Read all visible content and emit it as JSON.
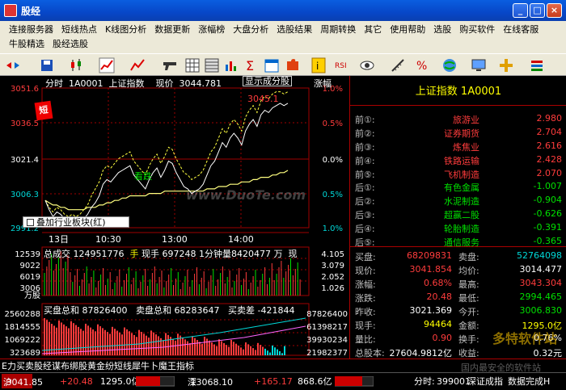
{
  "window": {
    "title": "股经"
  },
  "menu": {
    "row1": [
      "连接服务器",
      "短线热点",
      "K线图分析",
      "数据更新",
      "涨幅榜",
      "大盘分析",
      "选股结果",
      "周期转换",
      "其它",
      "使用帮助",
      "选股",
      "购买软件",
      "在线客服"
    ],
    "row2": [
      "牛股精选",
      "股经选股"
    ]
  },
  "chart": {
    "header": {
      "period": "分时",
      "code": "1A0001",
      "name": "上证指数",
      "price_label": "现价",
      "price": "3044.781",
      "toggle_label": "显示成分股",
      "change_label": "涨幅"
    },
    "y_left": [
      "3051.6",
      "3036.5",
      "3021.4",
      "3006.3",
      "2991.2"
    ],
    "y_right": [
      "1.0%",
      "0.5%",
      "0.0%",
      "0.5%",
      "1.0%"
    ],
    "x_labels": [
      "13日",
      "10:30",
      "13:00",
      "14:00"
    ],
    "peak_label": "3045.1",
    "buy_marker": "短",
    "sell_marker": "看跌",
    "overlay_checkbox": "叠加行业板块(红)",
    "volume_header": {
      "total_label": "总成交",
      "total": "124951776",
      "hand_label": "手",
      "current_label": "现手",
      "current": "697248",
      "sub": "1分钟量",
      "sub_value": "8420477",
      "unit": "万",
      "extra": "现"
    },
    "volume_y_left": [
      "12539",
      "9022",
      "6019",
      "3006",
      "万股"
    ],
    "volume_y_right": [
      "4.105",
      "3.079",
      "2.052",
      "1.026"
    ],
    "bs_header": {
      "buy_label": "买盘总和",
      "buy": "87826400",
      "sell_label": "卖盘总和",
      "sell": "68283647",
      "diff_label": "买卖差",
      "diff": "-421844"
    },
    "bs_y_left": [
      "2560288",
      "1814555",
      "1069222",
      "323689"
    ],
    "bs_y_right": [
      "87826400",
      "61398217",
      "39930234",
      "21982377"
    ],
    "series": {
      "price": [
        3003,
        2999,
        2996,
        2998,
        2997,
        2995,
        2994,
        2995,
        2993,
        2994,
        2995,
        2997,
        3000,
        3002,
        3005,
        3010,
        3012,
        3011,
        3013,
        3015,
        3016,
        3017,
        3018,
        3014,
        3012,
        3010,
        3008,
        3012,
        3015,
        3017,
        3013,
        3016,
        3020,
        3019,
        3015,
        3012,
        3009,
        3008,
        3006,
        3007,
        3008,
        3010,
        3014,
        3018,
        3020,
        3024,
        3028,
        3026,
        3030,
        3032,
        3030,
        3027,
        3033,
        3036,
        3038,
        3035,
        3040,
        3042,
        3041,
        3043,
        3044,
        3045,
        3044,
        3045
      ],
      "price_lead": [
        3003,
        3000,
        2998,
        3000,
        2999,
        2997,
        2996,
        2997,
        2996,
        2997,
        2999,
        3001,
        3005,
        3008,
        3011,
        3016,
        3018,
        3017,
        3019,
        3021,
        3022,
        3023,
        3024,
        3020,
        3018,
        3016,
        3014,
        3018,
        3021,
        3023,
        3019,
        3022,
        3026,
        3025,
        3021,
        3018,
        3015,
        3014,
        3012,
        3013,
        3014,
        3016,
        3020,
        3024,
        3026,
        3030,
        3034,
        3032,
        3036,
        3038,
        3036,
        3033,
        3039,
        3042,
        3044,
        3041,
        3046,
        3048,
        3047,
        3049,
        3050,
        3050,
        3049,
        3050
      ],
      "avg": [
        3003,
        3002,
        3001,
        3001,
        3000,
        3000,
        2999,
        2999,
        2999,
        2999,
        2999,
        3000,
        3000,
        3000,
        3001,
        3001,
        3002,
        3002,
        3003,
        3003,
        3004,
        3004,
        3005,
        3005,
        3005,
        3005,
        3005,
        3006,
        3006,
        3006,
        3006,
        3007,
        3007,
        3007,
        3007,
        3007,
        3007,
        3007,
        3007,
        3007,
        3007,
        3007,
        3008,
        3008,
        3008,
        3009,
        3009,
        3009,
        3010,
        3010,
        3010,
        3011,
        3011,
        3011,
        3012,
        3012,
        3013,
        3013,
        3013,
        3014,
        3014,
        3015,
        3015,
        3016
      ],
      "ref": 3021.369
    },
    "colors": {
      "up": "#ff3c3c",
      "down": "#00e000",
      "grid": "#a00000",
      "price": "#ffffff",
      "avg": "#ffff80",
      "lead": "#ffff40"
    }
  },
  "info": {
    "title": "上证指数  1A0001",
    "top5": [
      {
        "label": "前①:",
        "name": "旅游业",
        "value": "2.980"
      },
      {
        "label": "前②:",
        "name": "证券期货",
        "value": "2.704"
      },
      {
        "label": "前③:",
        "name": "炼焦业",
        "value": "2.616"
      },
      {
        "label": "前④:",
        "name": "铁路运输",
        "value": "2.428"
      },
      {
        "label": "前⑤:",
        "name": "飞机制造",
        "value": "2.070"
      }
    ],
    "bottom5": [
      {
        "label": "后①:",
        "name": "有色金属",
        "value": "-1.007"
      },
      {
        "label": "后②:",
        "name": "水泥制造",
        "value": "-0.904"
      },
      {
        "label": "后③:",
        "name": "超赢二股",
        "value": "-0.626"
      },
      {
        "label": "后④:",
        "name": "轮胎制造",
        "value": "-0.391"
      },
      {
        "label": "后⑤:",
        "name": "通信服务",
        "value": "-0.365"
      }
    ],
    "quote": [
      {
        "l1": "买盘:",
        "v1": "68209831",
        "c1": "red",
        "l2": "卖盘:",
        "v2": "52764098",
        "c2": "cyan"
      },
      {
        "l1": "现价:",
        "v1": "3041.854",
        "c1": "red",
        "l2": "均价:",
        "v2": "3014.477",
        "c2": "white"
      },
      {
        "l1": "涨幅:",
        "v1": "0.68%",
        "c1": "red",
        "l2": "最高:",
        "v2": "3043.304",
        "c2": "red"
      },
      {
        "l1": "涨跌:",
        "v1": "20.48",
        "c1": "red",
        "l2": "最低:",
        "v2": "2994.465",
        "c2": "green"
      },
      {
        "l1": "昨收:",
        "v1": "3021.369",
        "c1": "white",
        "l2": "今开:",
        "v2": "3006.830",
        "c2": "green"
      },
      {
        "l1": "现手:",
        "v1": "94464",
        "c1": "yellow",
        "l2": "金额:",
        "v2": "1295.0亿",
        "c2": "yellow"
      },
      {
        "l1": "量比:",
        "v1": "0.90",
        "c1": "red",
        "l2": "换手:",
        "v2": "0.76%",
        "c2": "white"
      },
      {
        "l1": "总股本:",
        "v1": "27604.9812亿",
        "c1": "white",
        "l2": "收益:",
        "v2": "0.32元",
        "c2": "white"
      }
    ]
  },
  "ticker": "E力买卖股经谋布绑股黄金纷短线犀牛卜魔王指标",
  "status": {
    "sh_code": "沪",
    "sh_price": "3041.85",
    "sh_change": "+20.48",
    "sh_amount": "1295.0亿",
    "sz_code": "深",
    "sz_price": "13068.10",
    "sz_change": "+165.17",
    "sz_amount": "868.6亿",
    "time_label": "分时:",
    "time_code": "399001",
    "market": "深证成指",
    "data_status": "数据完成H"
  },
  "watermark": "www.DuoTe.com",
  "watermark2": "多特软件站",
  "watermark3": "国内最安全的软件站"
}
